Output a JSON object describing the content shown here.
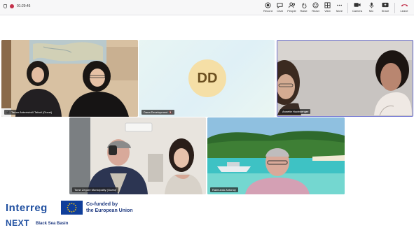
{
  "meeting": {
    "timer": "01:29:46",
    "recording_color": "#c4314b"
  },
  "toolbar": {
    "items": [
      {
        "label": "Record",
        "icon": "record-icon"
      },
      {
        "label": "Chat",
        "icon": "chat-icon"
      },
      {
        "label": "People",
        "icon": "people-icon"
      },
      {
        "label": "Raise",
        "icon": "raise-hand-icon"
      },
      {
        "label": "React",
        "icon": "react-icon"
      },
      {
        "label": "View",
        "icon": "view-icon"
      },
      {
        "label": "More",
        "icon": "more-icon"
      },
      {
        "label": "Camera",
        "icon": "camera-icon"
      },
      {
        "label": "Mic",
        "icon": "mic-icon"
      },
      {
        "label": "Share",
        "icon": "share-icon"
      },
      {
        "label": "Leave",
        "icon": "leave-icon"
      }
    ]
  },
  "participants": [
    {
      "name": "Tamar Askerishvili Tafadi (Guest)",
      "type": "video"
    },
    {
      "name": "Dana Development",
      "type": "avatar",
      "initials": "DD",
      "avatar_color": "#f5dfa6"
    },
    {
      "name": "Annette Hochwenger",
      "type": "video",
      "active_speaker": true
    },
    {
      "name": "Tome Zegore Municipality (Guest)",
      "type": "video"
    },
    {
      "name": "Raimundo Antonoy",
      "type": "video"
    }
  ],
  "footer": {
    "program_name": "Interreg",
    "cofunded_line1": "Co-funded by",
    "cofunded_line2": "the European Union",
    "next": "NEXT",
    "basin": "Black Sea Basin",
    "brand_color": "#1f4fa0",
    "eu_blue": "#0f3e9a",
    "eu_star": "#ffcc00"
  }
}
